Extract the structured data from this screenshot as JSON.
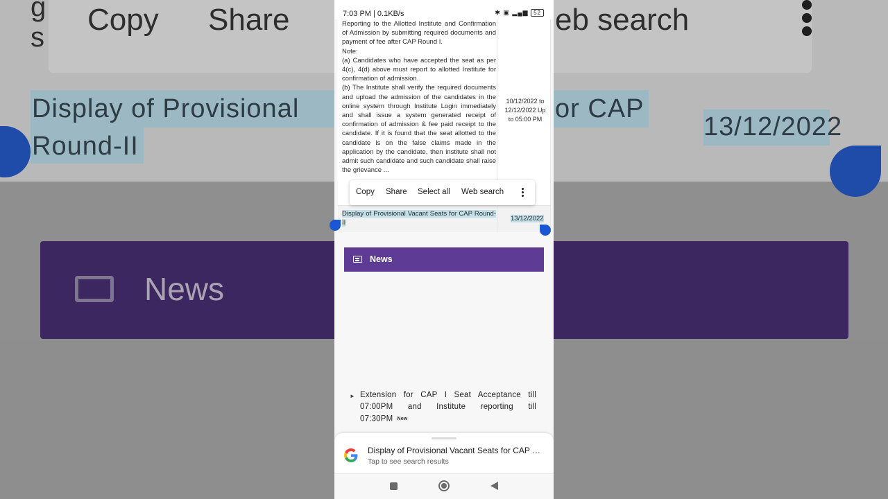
{
  "background": {
    "menu": {
      "copy": "Copy",
      "share": "Share",
      "web_search": "eb search"
    },
    "left_fragment_1": "g",
    "left_fragment_2": "s",
    "selected_line1": "Display  of  Provisional",
    "selected_line1_right": "or  CAP",
    "selected_line2": "Round-II",
    "selected_date": "13/12/2022",
    "news_label": "News"
  },
  "status_bar": {
    "time": "7:03 PM | 0.1KB/s",
    "icons": "✱ ▣ ▂▄▆",
    "battery": "52"
  },
  "table": {
    "row1": {
      "paragraphs": [
        "Reporting to the Allotted Institute and Confirmation of Admission by submitting required documents and payment of fee after CAP Round I.",
        "Note:",
        "(a) Candidates who have accepted the seat as per 4(c), 4(d) above must report to allotted Institute for confirmation of admission.",
        "(b) The Institute shall verify the required documents and upload the admission of the candidates in the online system through Institute Login immediately and shall issue a system generated receipt of confirmation of admission & fee paid receipt to the candidate. If it is found that the seat allotted to the candidate is on the false claims made in the application by the candidate, then institute shall not admit such candidate and such candidate shall raise the grievance ..."
      ],
      "date": "10/12/2022 to 12/12/2022 Up to 05:00 PM"
    },
    "row2": {
      "activity": "Display of Provisional Vacant Seats for CAP Round-II",
      "date": "13/12/2022"
    }
  },
  "context_menu": {
    "copy": "Copy",
    "share": "Share",
    "select_all": "Select all",
    "web_search": "Web search"
  },
  "news": {
    "title": "News",
    "items": [
      {
        "text": "Extension for CAP I Seat Acceptance till 07:00PM and Institute reporting till 07:30PM",
        "badge": "New"
      }
    ]
  },
  "search_sheet": {
    "title": "Display of Provisional Vacant Seats for CAP Round-II",
    "subtitle": "Tap to see search results"
  },
  "colors": {
    "news_purple": "#5e3b94",
    "selection": "#c2dfe8",
    "handle_blue": "#1a57d2"
  },
  "icons": [
    "telegram-icon",
    "video-icon",
    "bluetooth-icon",
    "signal-icon",
    "battery-icon",
    "news-icon",
    "google-icon",
    "more-vert-icon",
    "recents-icon",
    "home-icon",
    "back-icon"
  ]
}
